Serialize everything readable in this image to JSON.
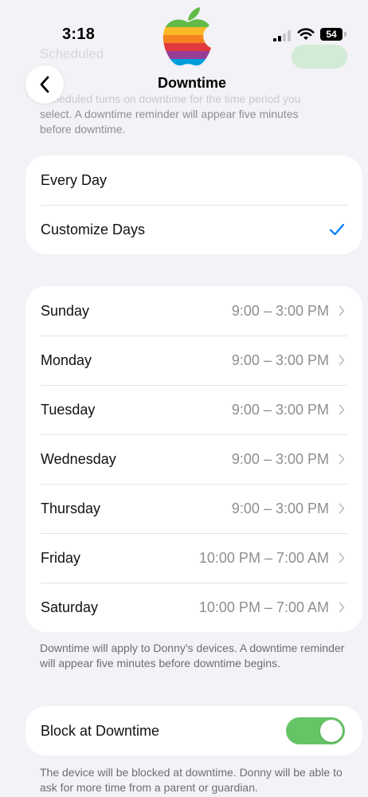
{
  "status_bar": {
    "time": "3:18",
    "battery": "54",
    "logo_icon": "rainbow-apple-logo"
  },
  "background": {
    "scheduled_label": "Scheduled",
    "description_line1_faded": "Scheduled turns on downtime for the time period you",
    "description_line2": "select. A downtime reminder will appear five minutes",
    "description_line3": "before downtime."
  },
  "nav": {
    "back_icon": "chevron-left-icon",
    "title": "Downtime"
  },
  "days_mode": {
    "options": [
      {
        "label": "Every Day",
        "selected": false
      },
      {
        "label": "Customize Days",
        "selected": true
      }
    ],
    "check_color": "#007aff"
  },
  "schedule": {
    "days": [
      {
        "day": "Sunday",
        "time": "9:00 – 3:00 PM"
      },
      {
        "day": "Monday",
        "time": "9:00 – 3:00 PM"
      },
      {
        "day": "Tuesday",
        "time": "9:00 – 3:00 PM"
      },
      {
        "day": "Wednesday",
        "time": "9:00 – 3:00 PM"
      },
      {
        "day": "Thursday",
        "time": "9:00 – 3:00 PM"
      },
      {
        "day": "Friday",
        "time": "10:00 PM – 7:00 AM"
      },
      {
        "day": "Saturday",
        "time": "10:00 PM – 7:00 AM"
      }
    ],
    "footnote": "Downtime will apply to Donny's devices. A downtime reminder will appear five minutes before downtime begins."
  },
  "block": {
    "label": "Block at Downtime",
    "enabled": true,
    "toggle_color": "#65c466",
    "footnote": "The device will be blocked at downtime. Donny will be able to ask for more time from a parent or guardian."
  }
}
